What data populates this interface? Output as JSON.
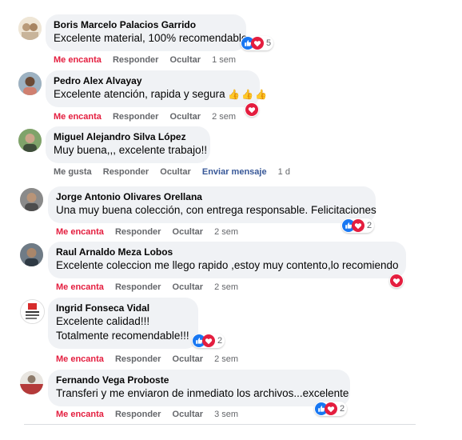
{
  "comments": [
    {
      "author": "Boris Marcelo Palacios Garrido",
      "text": "Excelente material, 100% recomendable.",
      "actions": {
        "react": "Me encanta",
        "reply": "Responder",
        "hide": "Ocultar",
        "time": "1 sem"
      },
      "reaction_count": "5"
    },
    {
      "author": "Pedro Alex Alvayay",
      "text": "Excelente atención, rapida y segura",
      "emoji": "👍👍👍",
      "actions": {
        "react": "Me encanta",
        "reply": "Responder",
        "hide": "Ocultar",
        "time": "2 sem"
      }
    },
    {
      "author": "Miguel Alejandro Silva López",
      "text": "Muy buena,,, excelente trabajo!!",
      "actions": {
        "react": "Me gusta",
        "reply": "Responder",
        "hide": "Ocultar",
        "message": "Enviar mensaje",
        "time": "1 d"
      }
    },
    {
      "author": "Jorge Antonio Olivares Orellana",
      "text": "Una muy buena colección, con entrega responsable. Felicitaciones",
      "actions": {
        "react": "Me encanta",
        "reply": "Responder",
        "hide": "Ocultar",
        "time": "2 sem"
      },
      "reaction_count": "2"
    },
    {
      "author": "Raul Arnaldo Meza Lobos",
      "text": "Excelente coleccion me llego rapido ,estoy muy contento,lo recomiendo",
      "actions": {
        "react": "Me encanta",
        "reply": "Responder",
        "hide": "Ocultar",
        "time": "2 sem"
      }
    },
    {
      "author": "Ingrid Fonseca Vidal",
      "text_lines": [
        "Excelente calidad!!!",
        "Totalmente recomendable!!!"
      ],
      "actions": {
        "react": "Me encanta",
        "reply": "Responder",
        "hide": "Ocultar",
        "time": "2 sem"
      },
      "reaction_count": "2"
    },
    {
      "author": "Fernando Vega Proboste",
      "text": "Transferi y me enviaron de inmediato los archivos...excelente",
      "actions": {
        "react": "Me encanta",
        "reply": "Responder",
        "hide": "Ocultar",
        "time": "3 sem"
      },
      "reaction_count": "2"
    }
  ],
  "colors": {
    "bubble": "#f0f2f5",
    "love": "#e41e3f",
    "like": "#1877f2",
    "meta": "#65676b",
    "link": "#385898"
  },
  "icons": {
    "like": "like-reaction-icon",
    "love": "love-reaction-icon"
  }
}
